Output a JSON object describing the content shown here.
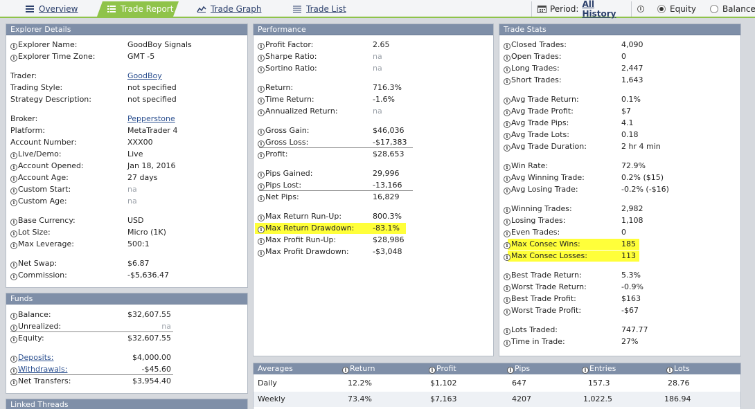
{
  "tabs": [
    {
      "label": "Overview",
      "icon": "list-icon"
    },
    {
      "label": "Trade Report",
      "icon": "table-icon"
    },
    {
      "label": "Trade Graph",
      "icon": "chart-icon"
    },
    {
      "label": "Trade List",
      "icon": "lines-icon"
    }
  ],
  "period": {
    "label": "Period:",
    "value": "All History"
  },
  "mode": {
    "equity": "Equity",
    "balance": "Balance",
    "selected": "Equity"
  },
  "explorer": {
    "title": "Explorer Details",
    "rows": [
      {
        "label": "Explorer Name:",
        "value": "GoodBoy Signals",
        "info": true
      },
      {
        "label": "Explorer Time Zone:",
        "value": "GMT -5",
        "info": true
      },
      {
        "label": "Trader:",
        "value": "GoodBoy",
        "link": true
      },
      {
        "label": "Trading Style:",
        "value": "not specified"
      },
      {
        "label": "Strategy Description:",
        "value": "not specified"
      },
      {
        "label": "Broker:",
        "value": "Pepperstone",
        "link": true
      },
      {
        "label": "Platform:",
        "value": "MetaTrader 4"
      },
      {
        "label": "Account Number:",
        "value": "XXX00"
      },
      {
        "label": "Live/Demo:",
        "value": "Live",
        "info": true
      },
      {
        "label": "Account Opened:",
        "value": "Jan 18, 2016",
        "info": true
      },
      {
        "label": "Account Age:",
        "value": "27 days",
        "info": true
      },
      {
        "label": "Custom Start:",
        "value": "na",
        "info": true,
        "muted": true
      },
      {
        "label": "Custom Age:",
        "value": "na",
        "info": true,
        "muted": true
      },
      {
        "label": "Base Currency:",
        "value": "USD",
        "info": true
      },
      {
        "label": "Lot Size:",
        "value": "Micro (1K)",
        "info": true
      },
      {
        "label": "Max Leverage:",
        "value": "500:1",
        "info": true
      },
      {
        "label": "Net Swap:",
        "value": "$6.87",
        "info": true
      },
      {
        "label": "Commission:",
        "value": "-$5,636.47",
        "info": true
      }
    ]
  },
  "funds": {
    "title": "Funds",
    "rows": [
      {
        "label": "Balance:",
        "value": "$32,607.55"
      },
      {
        "label": "Unrealized:",
        "value": "na"
      },
      {
        "label": "Equity:",
        "value": "$32,607.55"
      },
      {
        "label": "Deposits:",
        "value": "$4,000.00"
      },
      {
        "label": "Withdrawals:",
        "value": "-$45.60"
      },
      {
        "label": "Net Transfers:",
        "value": "$3,954.40"
      }
    ]
  },
  "linked": {
    "title": "Linked Threads"
  },
  "performance": {
    "title": "Performance",
    "rows": [
      {
        "label": "Profit Factor:",
        "value": "2.65"
      },
      {
        "label": "Sharpe Ratio:",
        "value": "na"
      },
      {
        "label": "Sortino Ratio:",
        "value": "na"
      },
      {
        "label": "Return:",
        "value": "716.3%"
      },
      {
        "label": "Time Return:",
        "value": "-1.6%"
      },
      {
        "label": "Annualized Return:",
        "value": "na"
      },
      {
        "label": "Gross Gain:",
        "value": "$46,036"
      },
      {
        "label": "Gross Loss:",
        "value": "-$17,383"
      },
      {
        "label": "Profit:",
        "value": "$28,653"
      },
      {
        "label": "Pips Gained:",
        "value": "29,996"
      },
      {
        "label": "Pips Lost:",
        "value": "-13,166"
      },
      {
        "label": "Net Pips:",
        "value": "16,829"
      },
      {
        "label": "Max Return Run-Up:",
        "value": "800.3%"
      },
      {
        "label": "Max Return Drawdown:",
        "value": "-83.1%"
      },
      {
        "label": "Max Profit Run-Up:",
        "value": "$28,986"
      },
      {
        "label": "Max Profit Drawdown:",
        "value": "-$3,048"
      }
    ]
  },
  "stats": {
    "title": "Trade Stats",
    "rows": [
      {
        "label": "Closed Trades:",
        "value": "4,090"
      },
      {
        "label": "Open Trades:",
        "value": "0"
      },
      {
        "label": "Long Trades:",
        "value": "2,447"
      },
      {
        "label": "Short Trades:",
        "value": "1,643"
      },
      {
        "label": "Avg Trade Return:",
        "value": "0.1%"
      },
      {
        "label": "Avg Trade Profit:",
        "value": "$7"
      },
      {
        "label": "Avg Trade Pips:",
        "value": "4.1"
      },
      {
        "label": "Avg Trade Lots:",
        "value": "0.18"
      },
      {
        "label": "Avg Trade Duration:",
        "value": "2 hr 4 min"
      },
      {
        "label": "Win Rate:",
        "value": "72.9%"
      },
      {
        "label": "Avg Winning Trade:",
        "value": "0.2% ($15)"
      },
      {
        "label": "Avg Losing Trade:",
        "value": "-0.2% (-$16)"
      },
      {
        "label": "Winning Trades:",
        "value": "2,982"
      },
      {
        "label": "Losing Trades:",
        "value": "1,108"
      },
      {
        "label": "Even Trades:",
        "value": "0"
      },
      {
        "label": "Max Consec Wins:",
        "value": "185"
      },
      {
        "label": "Max Consec Losses:",
        "value": "113"
      },
      {
        "label": "Best Trade Return:",
        "value": "5.3%"
      },
      {
        "label": "Worst Trade Return:",
        "value": "-0.9%"
      },
      {
        "label": "Best Trade Profit:",
        "value": "$163"
      },
      {
        "label": "Worst Trade Profit:",
        "value": "-$67"
      },
      {
        "label": "Lots Traded:",
        "value": "747.77"
      },
      {
        "label": "Time in Trade:",
        "value": "27%"
      }
    ]
  },
  "averages": {
    "headers": [
      "Averages",
      "Return",
      "Profit",
      "Pips",
      "Entries",
      "Lots"
    ],
    "rows": [
      {
        "period": "Daily",
        "return": "12.2%",
        "profit": "$1,102",
        "pips": "647",
        "entries": "157.3",
        "lots": "28.76"
      },
      {
        "period": "Weekly",
        "return": "73.4%",
        "profit": "$7,163",
        "pips": "4207",
        "entries": "1,022.5",
        "lots": "186.94"
      }
    ]
  },
  "colors": {
    "accent": "#8fc34a",
    "panel_header": "#7f8fa8",
    "highlight": "#ffff3a",
    "link": "#2b4f8f"
  }
}
